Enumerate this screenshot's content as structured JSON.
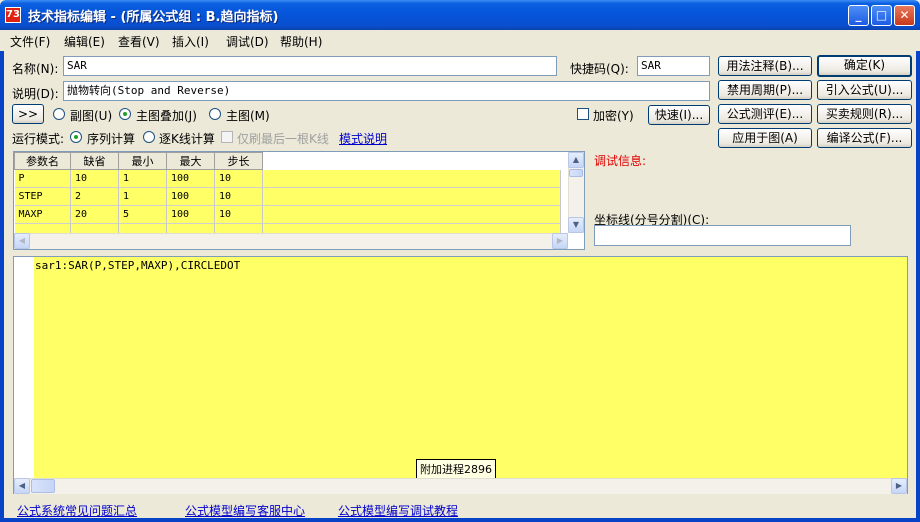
{
  "window": {
    "title": "技术指标编辑 - (所属公式组 : B.趋向指标)",
    "app_icon_label": "73"
  },
  "menu": [
    "文件(F)",
    "编辑(E)",
    "查看(V)",
    "插入(I)",
    "调试(D)",
    "帮助(H)"
  ],
  "form": {
    "name_label": "名称(N):",
    "name_value": "SAR",
    "shortcut_label": "快捷码(Q):",
    "shortcut_value": "SAR",
    "desc_label": "说明(D):",
    "desc_value": "抛物转向(Stop and Reverse)",
    "expand_label": ">>",
    "display": {
      "options": [
        "副图(U)",
        "主图叠加(J)",
        "主图(M)"
      ],
      "selected": 1
    },
    "encrypt_label": "加密(Y)",
    "run_mode_label": "运行模式:",
    "run_modes": [
      "序列计算",
      "逐K线计算"
    ],
    "run_mode_selected": 0,
    "last_bar_only_label": "仅刷最后一根K线",
    "mode_help_link": "模式说明"
  },
  "buttons": {
    "usage_notes": "用法注释(B)...",
    "confirm": "确定(K)",
    "disable_period": "禁用周期(P)...",
    "import_formula": "引入公式(U)...",
    "quick": "快速(I)...",
    "formula_eval": "公式测评(E)...",
    "trade_rules": "买卖规则(R)...",
    "apply_to_chart": "应用于图(A)",
    "compile": "编译公式(F)..."
  },
  "params": {
    "columns": [
      "参数名",
      "缺省",
      "最小",
      "最大",
      "步长"
    ],
    "rows": [
      [
        "P",
        "10",
        "1",
        "100",
        "10"
      ],
      [
        "STEP",
        "2",
        "1",
        "100",
        "10"
      ],
      [
        "MAXP",
        "20",
        "5",
        "100",
        "10"
      ]
    ]
  },
  "debug": {
    "label": "调试信息:",
    "axis_label": "坐标线(分号分割)(C):",
    "axis_value": ""
  },
  "editor": {
    "code": "sar1:SAR(P,STEP,MAXP),CIRCLEDOT"
  },
  "tooltip": "附加进程2896",
  "footer_links": [
    "公式系统常见问题汇总",
    "公式模型编写客服中心",
    "公式模型编写调试教程"
  ]
}
